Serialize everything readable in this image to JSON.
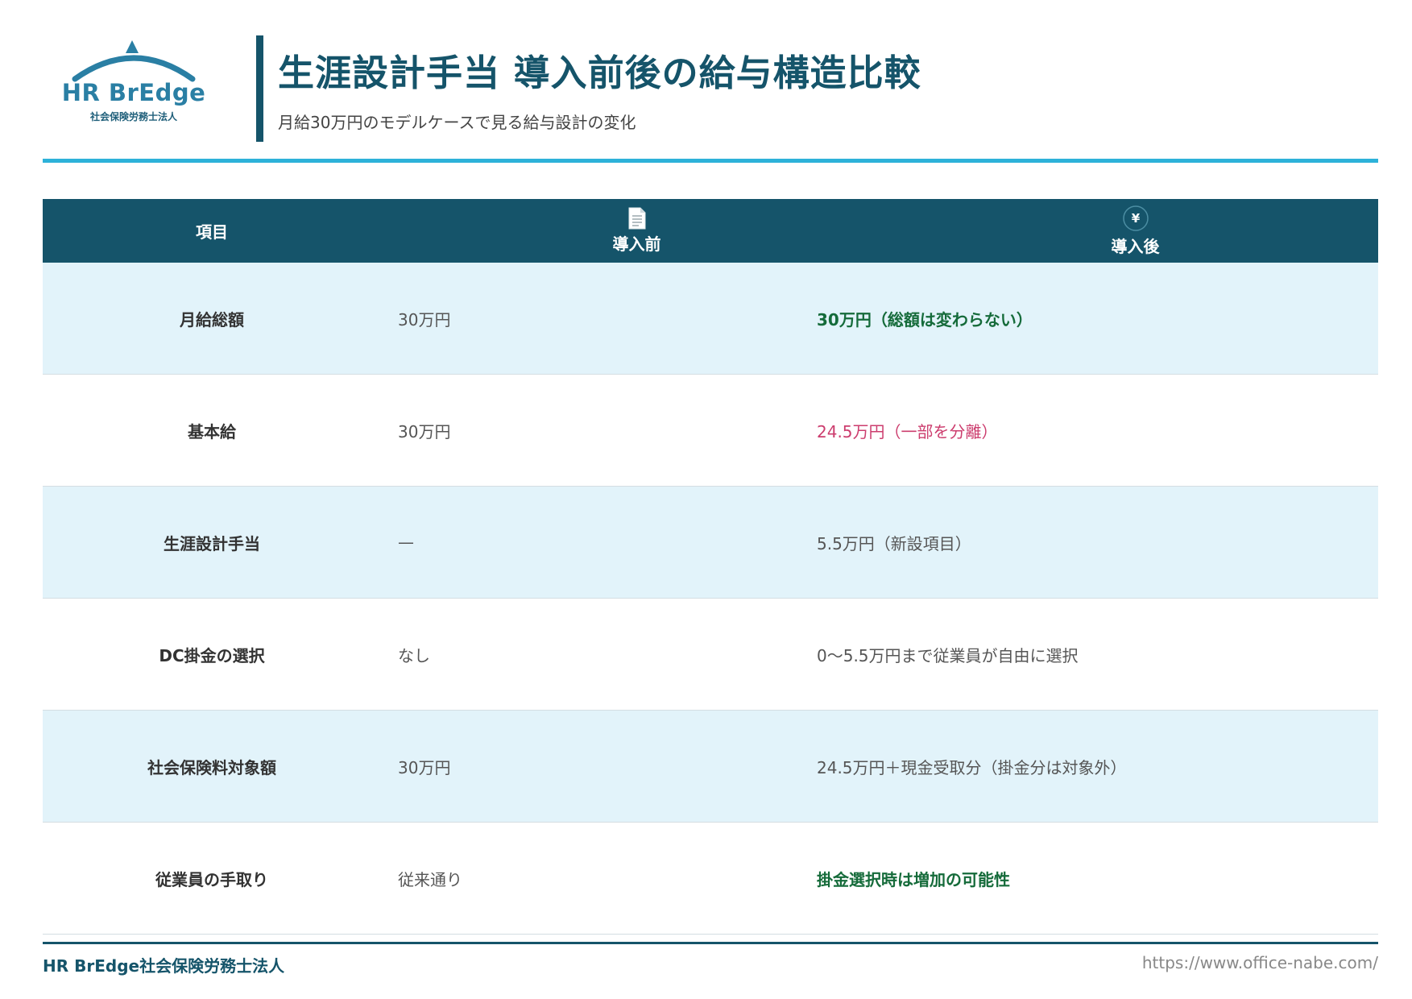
{
  "logo": {
    "name": "HR BrEdge",
    "sub": "社会保険労務士法人"
  },
  "title": "生涯設計手当 導入前後の給与構造比較",
  "subtitle": "月給30万円のモデルケースで見る給与設計の変化",
  "table": {
    "headers": {
      "item": "項目",
      "before": "導入前",
      "after": "導入後",
      "before_icon": "document-icon",
      "after_icon": "yen-icon",
      "after_icon_glyph": "¥"
    },
    "rows": [
      {
        "item": "月給総額",
        "before": "30万円",
        "after": "30万円（総額は変わらない）",
        "after_style": "green"
      },
      {
        "item": "基本給",
        "before": "30万円",
        "after": "24.5万円（一部を分離）",
        "after_style": "pink"
      },
      {
        "item": "生涯設計手当",
        "before": "—",
        "after": "5.5万円（新設項目）",
        "after_style": "normal"
      },
      {
        "item": "DC掛金の選択",
        "before": "なし",
        "after": "0〜5.5万円まで従業員が自由に選択",
        "after_style": "normal"
      },
      {
        "item": "社会保険料対象額",
        "before": "30万円",
        "after": "24.5万円＋現金受取分（掛金分は対象外）",
        "after_style": "normal"
      },
      {
        "item": "従業員の手取り",
        "before": "従来通り",
        "after": "掛金選択時は増加の可能性",
        "after_style": "green"
      }
    ]
  },
  "footer": {
    "left": "HR BrEdge社会保険労務士法人",
    "right": "https://www.office-nabe.com/"
  },
  "colors": {
    "primary": "#15546a",
    "accent": "#2db2d9",
    "row_alt": "#e2f3fa",
    "green": "#156b3a",
    "pink": "#cc3d6e"
  }
}
